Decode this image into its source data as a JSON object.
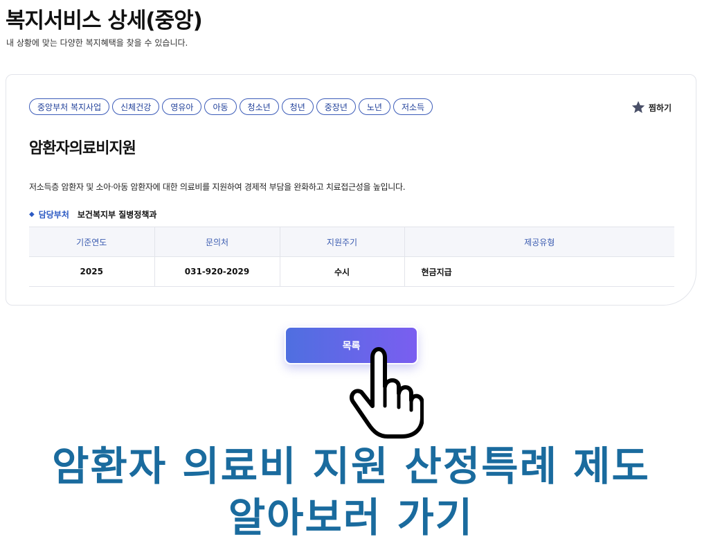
{
  "header": {
    "title": "복지서비스 상세(중앙)",
    "subtitle": "내 상황에 맞는 다양한 복지혜택을 찾을 수 있습니다."
  },
  "service": {
    "tags": [
      "중앙부처 복지사업",
      "신체건강",
      "영유아",
      "아동",
      "청소년",
      "청년",
      "중장년",
      "노년",
      "저소득"
    ],
    "favorite_label": "찜하기",
    "title": "암환자의료비지원",
    "description": "저소득층 암환자 및 소아·아동 암환자에 대한 의료비를 지원하여 경제적 부담을 완화하고 치료접근성을 높입니다.",
    "dept_label": "담당부처",
    "dept_value": "보건복지부 질병정책과",
    "table": {
      "headers": [
        "기준연도",
        "문의처",
        "지원주기",
        "제공유형"
      ],
      "rows": [
        [
          "2025",
          "031-920-2029",
          "수시",
          "현금지급"
        ]
      ]
    }
  },
  "actions": {
    "list_label": "목록"
  },
  "banner": {
    "line1": "암환자 의료비 지원 산정특례 제도",
    "line2": "알아보러 가기"
  },
  "colors": {
    "accent": "#3b5bb8",
    "banner": "#1a6b9e",
    "button_start": "#4f6fe0",
    "button_end": "#7a5ef0"
  },
  "icons": {
    "favorite": "star-icon",
    "pointer": "pointing-hand-icon"
  }
}
